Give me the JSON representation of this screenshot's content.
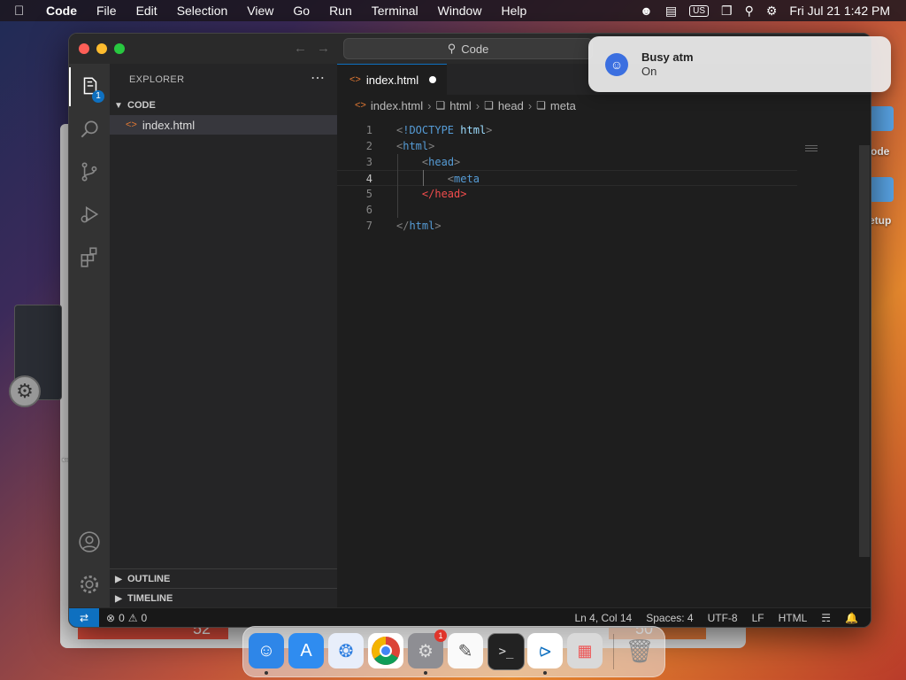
{
  "menubar": {
    "app": "Code",
    "items": [
      "File",
      "Edit",
      "Selection",
      "View",
      "Go",
      "Run",
      "Terminal",
      "Window",
      "Help"
    ],
    "input_source": "US",
    "clock": "Fri Jul 21  1:42 PM"
  },
  "window": {
    "search_label": "Code"
  },
  "sidebar": {
    "title": "EXPLORER",
    "folder": "CODE",
    "file": "index.html",
    "outline": "OUTLINE",
    "timeline": "TIMELINE",
    "explorer_badge": "1"
  },
  "editor": {
    "tab_label": "index.html",
    "breadcrumb": [
      "index.html",
      "html",
      "head",
      "meta"
    ],
    "line_numbers": [
      "1",
      "2",
      "3",
      "4",
      "5",
      "6",
      "7"
    ],
    "current_line": 4
  },
  "statusbar": {
    "errors": "0",
    "warnings": "0",
    "position": "Ln 4, Col 14",
    "spaces": "Spaces: 4",
    "encoding": "UTF-8",
    "eol": "LF",
    "language": "HTML"
  },
  "notification": {
    "title": "Busy atm",
    "body": "On"
  },
  "desktop": {
    "labels": [
      "ode",
      "etup"
    ]
  },
  "background": {
    "tile_left": "52",
    "tile_right": "50"
  },
  "dock": {
    "items": [
      "finder-icon",
      "app-store-icon",
      "safari-icon",
      "chrome-icon",
      "system-settings-icon",
      "textedit-icon",
      "terminal-icon",
      "vscode-icon",
      "launchpad-icon",
      "trash-icon"
    ],
    "settings_badge": "1"
  },
  "colors": {
    "accent": "#0e70c0",
    "tag": "#569cd6",
    "error_tag": "#f14c4c"
  }
}
